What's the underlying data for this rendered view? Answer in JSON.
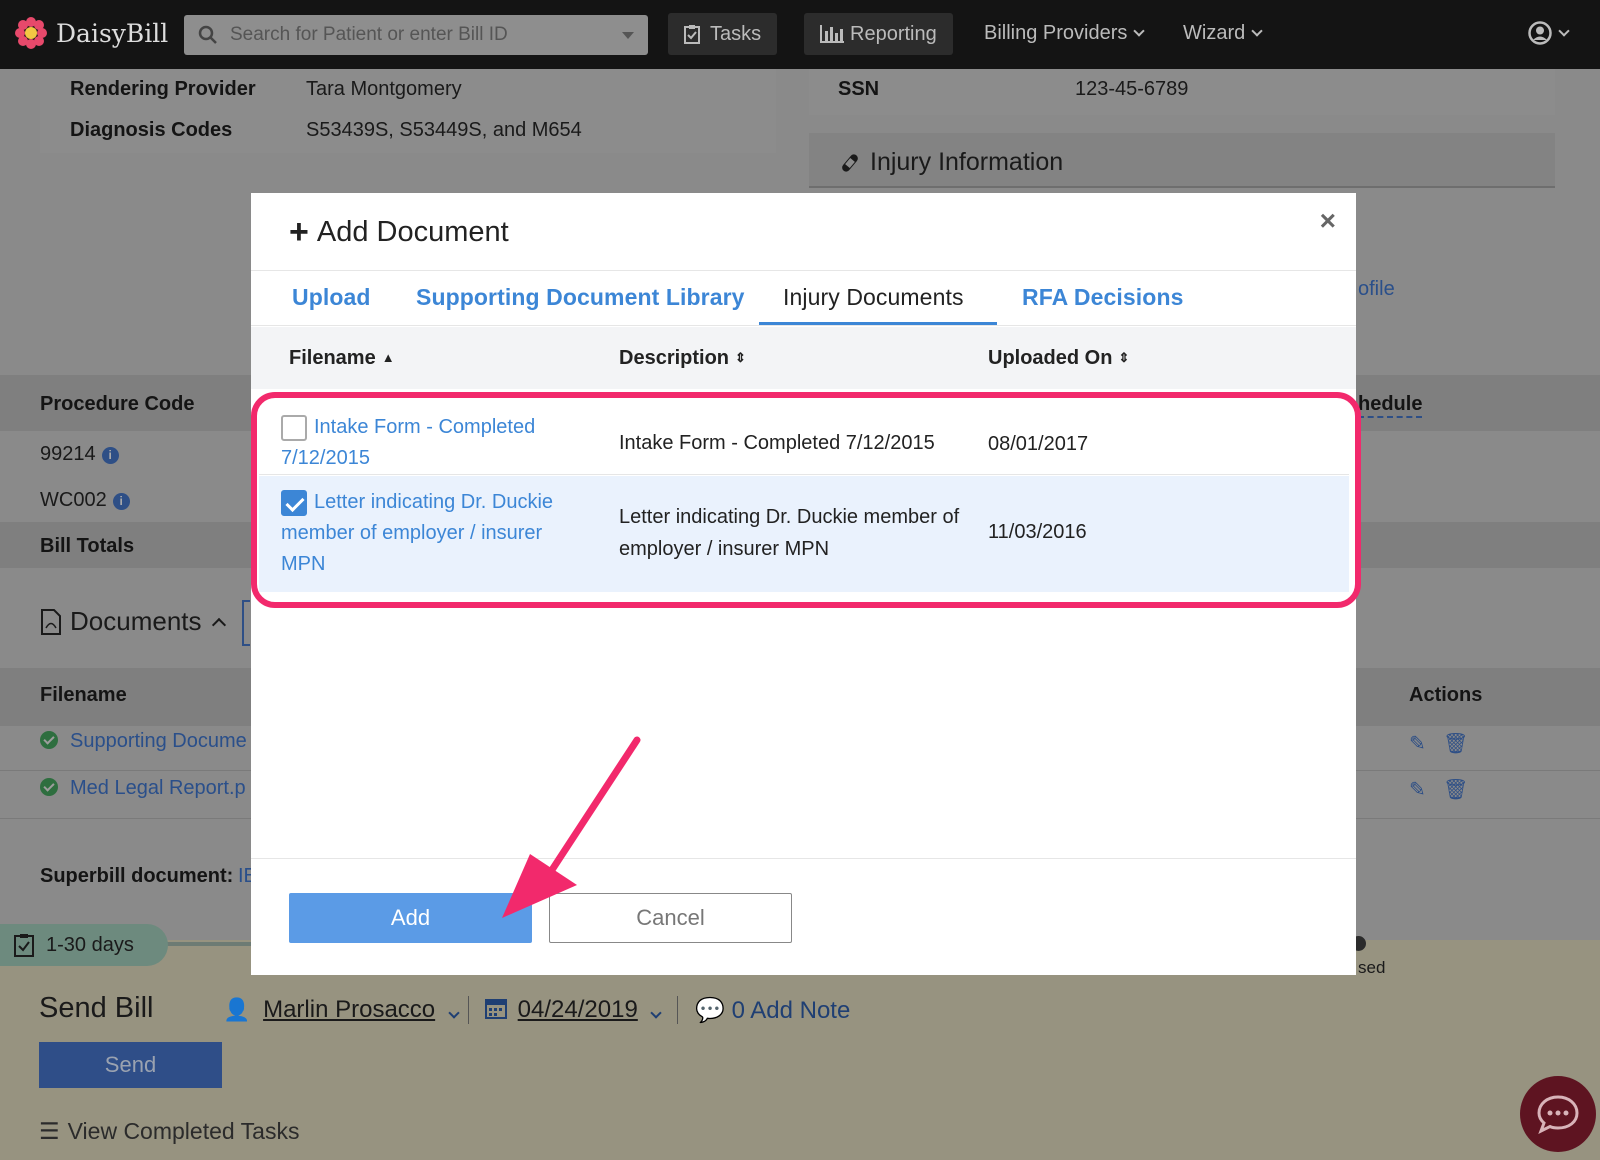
{
  "navbar": {
    "brand": "DaisyBill",
    "search_placeholder": "Search for Patient or enter Bill ID",
    "tasks": "Tasks",
    "reporting": "Reporting",
    "billing_providers": "Billing Providers",
    "wizard": "Wizard"
  },
  "background": {
    "rendering_provider_label": "Rendering Provider",
    "rendering_provider_value": "Tara Montgomery",
    "diagnosis_codes_label": "Diagnosis Codes",
    "diagnosis_codes_value": "S53439S, S53449S, and M654",
    "ssn_label": "SSN",
    "ssn_value": "123-45-6789",
    "injury_information": "Injury Information",
    "profile_fragment": "ofile",
    "schedule_fragment": "hedule",
    "procedure_code_header": "Procedure Code",
    "procedure_codes": [
      "99214",
      "WC002"
    ],
    "bill_totals": "Bill Totals",
    "documents_title": "Documents",
    "filename_header": "Filename",
    "actions_header": "Actions",
    "documents": [
      "Supporting Docume",
      "Med Legal Report.p"
    ],
    "superbill_label": "Superbill document:",
    "superbill_link": "IE",
    "status_fragment": "sed"
  },
  "footer": {
    "days_pill": "1-30 days",
    "send_bill_title": "Send Bill",
    "assignee": "Marlin Prosacco",
    "date": "04/24/2019",
    "notes": "0 Add Note",
    "send_button": "Send",
    "view_completed_tasks": "View Completed Tasks"
  },
  "modal": {
    "title": "Add Document",
    "close": "×",
    "tabs": [
      {
        "label": "Upload",
        "active": false
      },
      {
        "label": "Supporting Document Library",
        "active": false
      },
      {
        "label": "Injury Documents",
        "active": true
      },
      {
        "label": "RFA Decisions",
        "active": false
      }
    ],
    "columns": {
      "filename": "Filename",
      "description": "Description",
      "uploaded_on": "Uploaded On"
    },
    "rows": [
      {
        "filename": "Intake Form - Completed 7/12/2015",
        "description": "Intake Form - Completed 7/12/2015",
        "uploaded_on": "08/01/2017",
        "checked": false
      },
      {
        "filename": "Letter indicating Dr. Duckie member of employer / insurer MPN",
        "description": "Letter indicating Dr. Duckie member of employer / insurer MPN",
        "uploaded_on": "11/03/2016",
        "checked": true
      }
    ],
    "add_button": "Add",
    "cancel_button": "Cancel"
  },
  "colors": {
    "accent": "#3c86d6",
    "highlight": "#f2296c",
    "add_button": "#5b9be6"
  }
}
